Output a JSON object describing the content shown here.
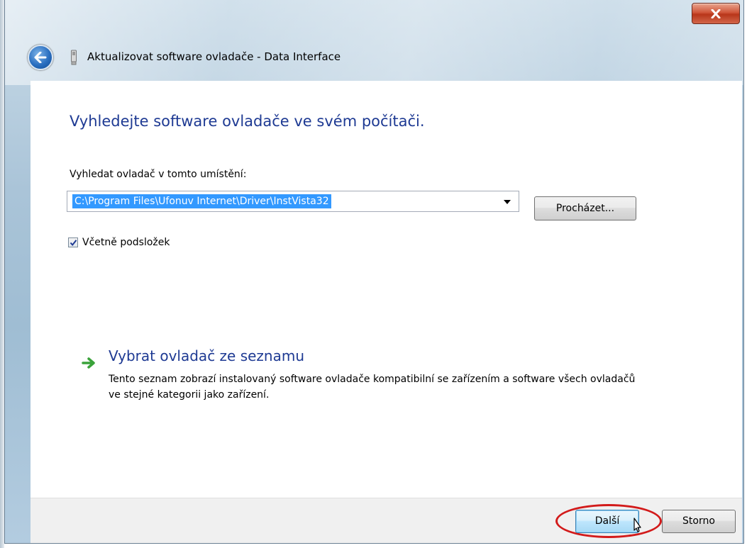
{
  "window": {
    "title": "Aktualizovat software ovladače - Data Interface"
  },
  "main": {
    "heading": "Vyhledejte software ovladače ve svém počítači.",
    "search_label": "Vyhledat ovladač v tomto umístění:",
    "path_value": "C:\\Program Files\\Ufonuv Internet\\Driver\\InstVista32",
    "browse_label": "Procházet...",
    "include_subfolders_label": "Včetně podsložek",
    "include_subfolders_checked": true,
    "option": {
      "title": "Vybrat ovladač ze seznamu",
      "description": "Tento seznam zobrazí instalovaný software ovladače kompatibilní se zařízením a software všech ovladačů ve stejné kategorii jako zařízení."
    }
  },
  "footer": {
    "next_label": "Další",
    "cancel_label": "Storno"
  },
  "colors": {
    "heading": "#1e3a93",
    "selection": "#3399ff",
    "highlight_circle": "#d21a1a",
    "option_arrow": "#3aa23a"
  },
  "icons": {
    "back": "back-arrow-icon",
    "device": "usb-device-icon",
    "close": "close-x-icon",
    "option": "green-arrow-icon",
    "dropdown": "dropdown-arrow-icon",
    "cursor": "mouse-pointer-icon"
  }
}
